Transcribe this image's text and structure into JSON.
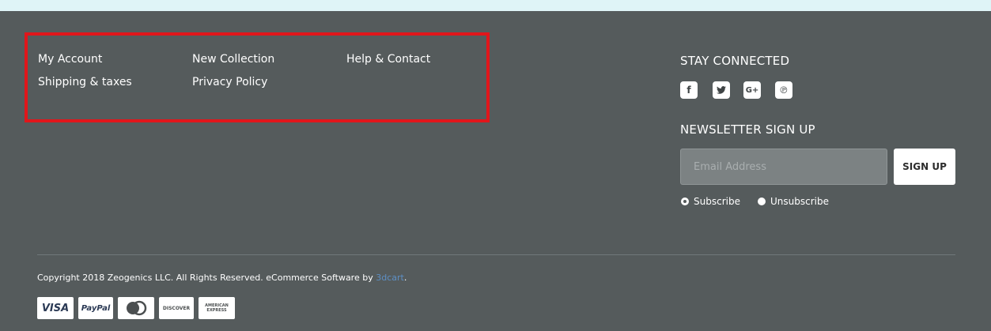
{
  "footer_links": {
    "col1": [
      "My Account",
      "Shipping & taxes"
    ],
    "col2": [
      "New Collection",
      "Privacy Policy"
    ],
    "col3": [
      "Help & Contact"
    ]
  },
  "stay_connected": {
    "heading": "STAY CONNECTED",
    "icons": [
      "facebook-icon",
      "twitter-icon",
      "google-plus-icon",
      "pinterest-icon"
    ]
  },
  "newsletter": {
    "heading": "NEWSLETTER SIGN UP",
    "email_placeholder": "Email Address",
    "button_label": "SIGN UP",
    "options": [
      "Subscribe",
      "Unsubscribe"
    ],
    "selected": "Subscribe"
  },
  "copyright": {
    "text": "Copyright 2018 Zeogenics LLC. All Rights Reserved. eCommerce Software by ",
    "link_text": "3dcart",
    "suffix": "."
  },
  "payment_cards": {
    "visa": "VISA",
    "paypal": "PayPal",
    "mastercard": "mastercard-logo",
    "discover": "DISCOVER",
    "amex": "AMERICAN EXPRESS"
  },
  "colors": {
    "background": "#555b5c",
    "top_strip": "#dff4f7",
    "highlight_border": "#e0161b",
    "link_accent": "#5d8fc4"
  }
}
